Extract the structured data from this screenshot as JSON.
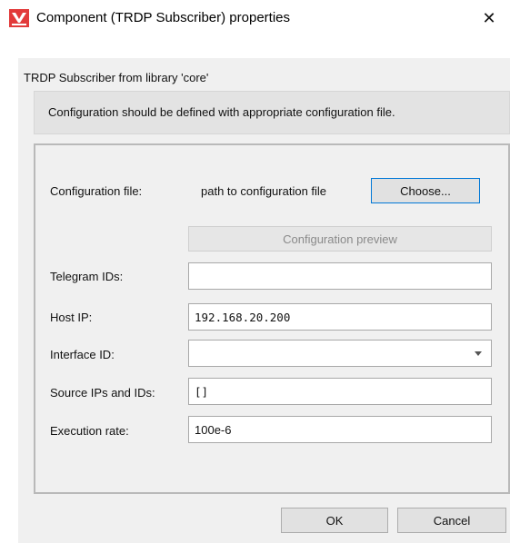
{
  "window": {
    "title": "Component (TRDP Subscriber) properties",
    "close_glyph": "✕",
    "icon": "app-logo-icon",
    "accent": "#e23a3a"
  },
  "dialog": {
    "subtitle": "TRDP Subscriber from library 'core'",
    "info": "Configuration should be defined with appropriate configuration file."
  },
  "form": {
    "config_file_label": "Configuration file:",
    "config_file_path": "path to configuration file",
    "choose_button": "Choose...",
    "preview_button": "Configuration preview",
    "telegram_ids_label": "Telegram IDs:",
    "telegram_ids_value": "",
    "host_ip_label": "Host IP:",
    "host_ip_value": "192.168.20.200",
    "interface_id_label": "Interface ID:",
    "interface_id_value": "",
    "source_ips_label": "Source IPs and IDs:",
    "source_ips_value": "[]",
    "execution_rate_label": "Execution rate:",
    "execution_rate_value": "100e-6"
  },
  "footer": {
    "ok_label": "OK",
    "cancel_label": "Cancel"
  }
}
